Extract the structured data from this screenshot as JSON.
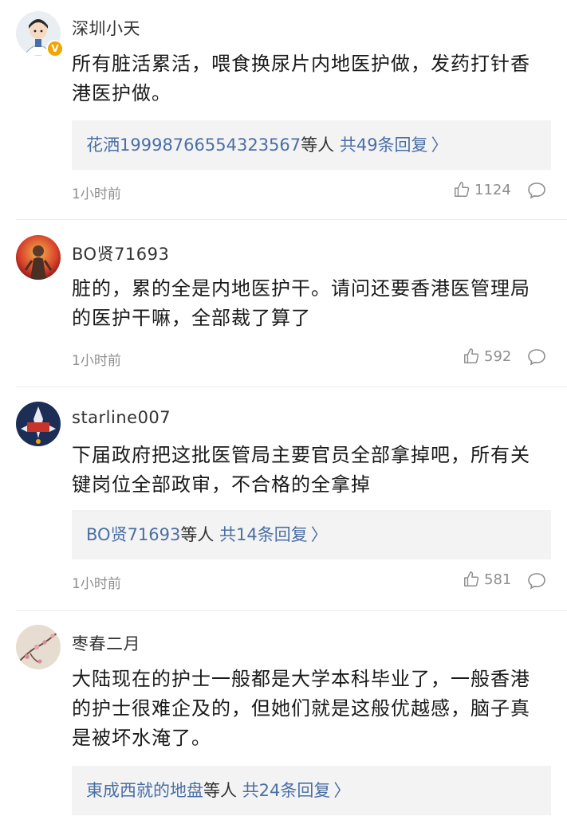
{
  "comments": [
    {
      "username": "深圳小天",
      "content": "所有脏活累活，喂食换尿片内地医护做，发药打针香港医护做。",
      "replies": {
        "who": "花洒19998766554323567",
        "etc": "等人",
        "count": "共49条回复"
      },
      "time": "1小时前",
      "likes": "1124",
      "avatar": "avatar-doctor-cartoon-icon",
      "verified_badge": "V"
    },
    {
      "username": "BO贤71693",
      "content": "脏的，累的全是内地医护干。请问还要香港医管理局的医护干嘛，全部裁了算了",
      "time": "1小时前",
      "likes": "592",
      "avatar": "avatar-red-figure-icon"
    },
    {
      "username": "starline007",
      "content": "下届政府把这批医管局主要官员全部拿掉吧，所有关键岗位全部政审，不合格的全拿掉",
      "replies": {
        "who": "BO贤71693",
        "etc": "等人",
        "count": "共14条回复"
      },
      "time": "1小时前",
      "likes": "581",
      "avatar": "avatar-space-badge-icon"
    },
    {
      "username": "枣春二月",
      "content": "大陆现在的护士一般都是大学本科毕业了，一般香港的护士很难企及的，但她们就是这般优越感，脑子真是被坏水淹了。",
      "replies": {
        "who": "東成西就的地盘",
        "etc": "等人",
        "count": "共24条回复"
      },
      "avatar": "avatar-blossom-painting-icon"
    }
  ],
  "colors": {
    "link": "#4a6fa5",
    "meta": "#8e8e8e",
    "reply_bg": "#f3f3f3",
    "divider": "#ececec"
  }
}
